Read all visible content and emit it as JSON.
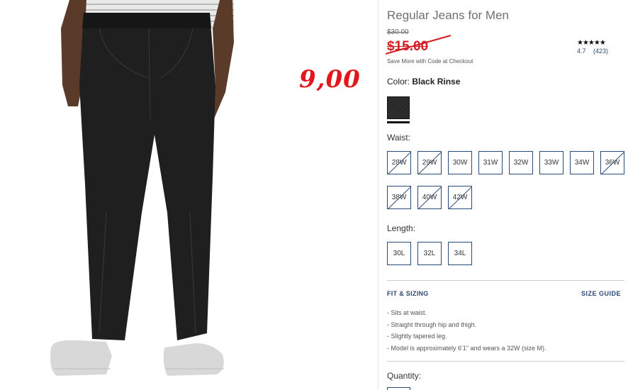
{
  "product": {
    "title": "Regular Jeans for Men",
    "original_price": "$30.00",
    "sale_price": "$15.00",
    "handwritten_price": "9,00",
    "promo": "Save More with Code at Checkout",
    "rating": {
      "stars": "★★★★★",
      "score": "4.7",
      "count": "(423)"
    }
  },
  "color": {
    "label": "Color:",
    "value": "Black Rinse",
    "swatch_hex": "#2a2a2a"
  },
  "waist": {
    "label": "Waist:",
    "sizes": [
      {
        "label": "28W",
        "available": false
      },
      {
        "label": "29W",
        "available": false
      },
      {
        "label": "30W",
        "available": true
      },
      {
        "label": "31W",
        "available": true
      },
      {
        "label": "32W",
        "available": true
      },
      {
        "label": "33W",
        "available": true
      },
      {
        "label": "34W",
        "available": true
      },
      {
        "label": "36W",
        "available": false
      },
      {
        "label": "38W",
        "available": false
      },
      {
        "label": "40W",
        "available": false
      },
      {
        "label": "42W",
        "available": false
      }
    ]
  },
  "length": {
    "label": "Length:",
    "sizes": [
      {
        "label": "30L",
        "available": true
      },
      {
        "label": "32L",
        "available": true
      },
      {
        "label": "34L",
        "available": true
      }
    ]
  },
  "fit": {
    "heading": "FIT & SIZING",
    "size_guide": "SIZE GUIDE",
    "points": [
      "Sits at waist.",
      "Straight through hip and thigh.",
      "Slightly tapered leg.",
      "Model is approximately 6'1\" and wears a 32W (size M)."
    ]
  },
  "quantity": {
    "label": "Quantity:"
  },
  "colors": {
    "accent": "#2b4a76",
    "sale_red": "#d21f26",
    "annotation_red": "#e3161b"
  }
}
